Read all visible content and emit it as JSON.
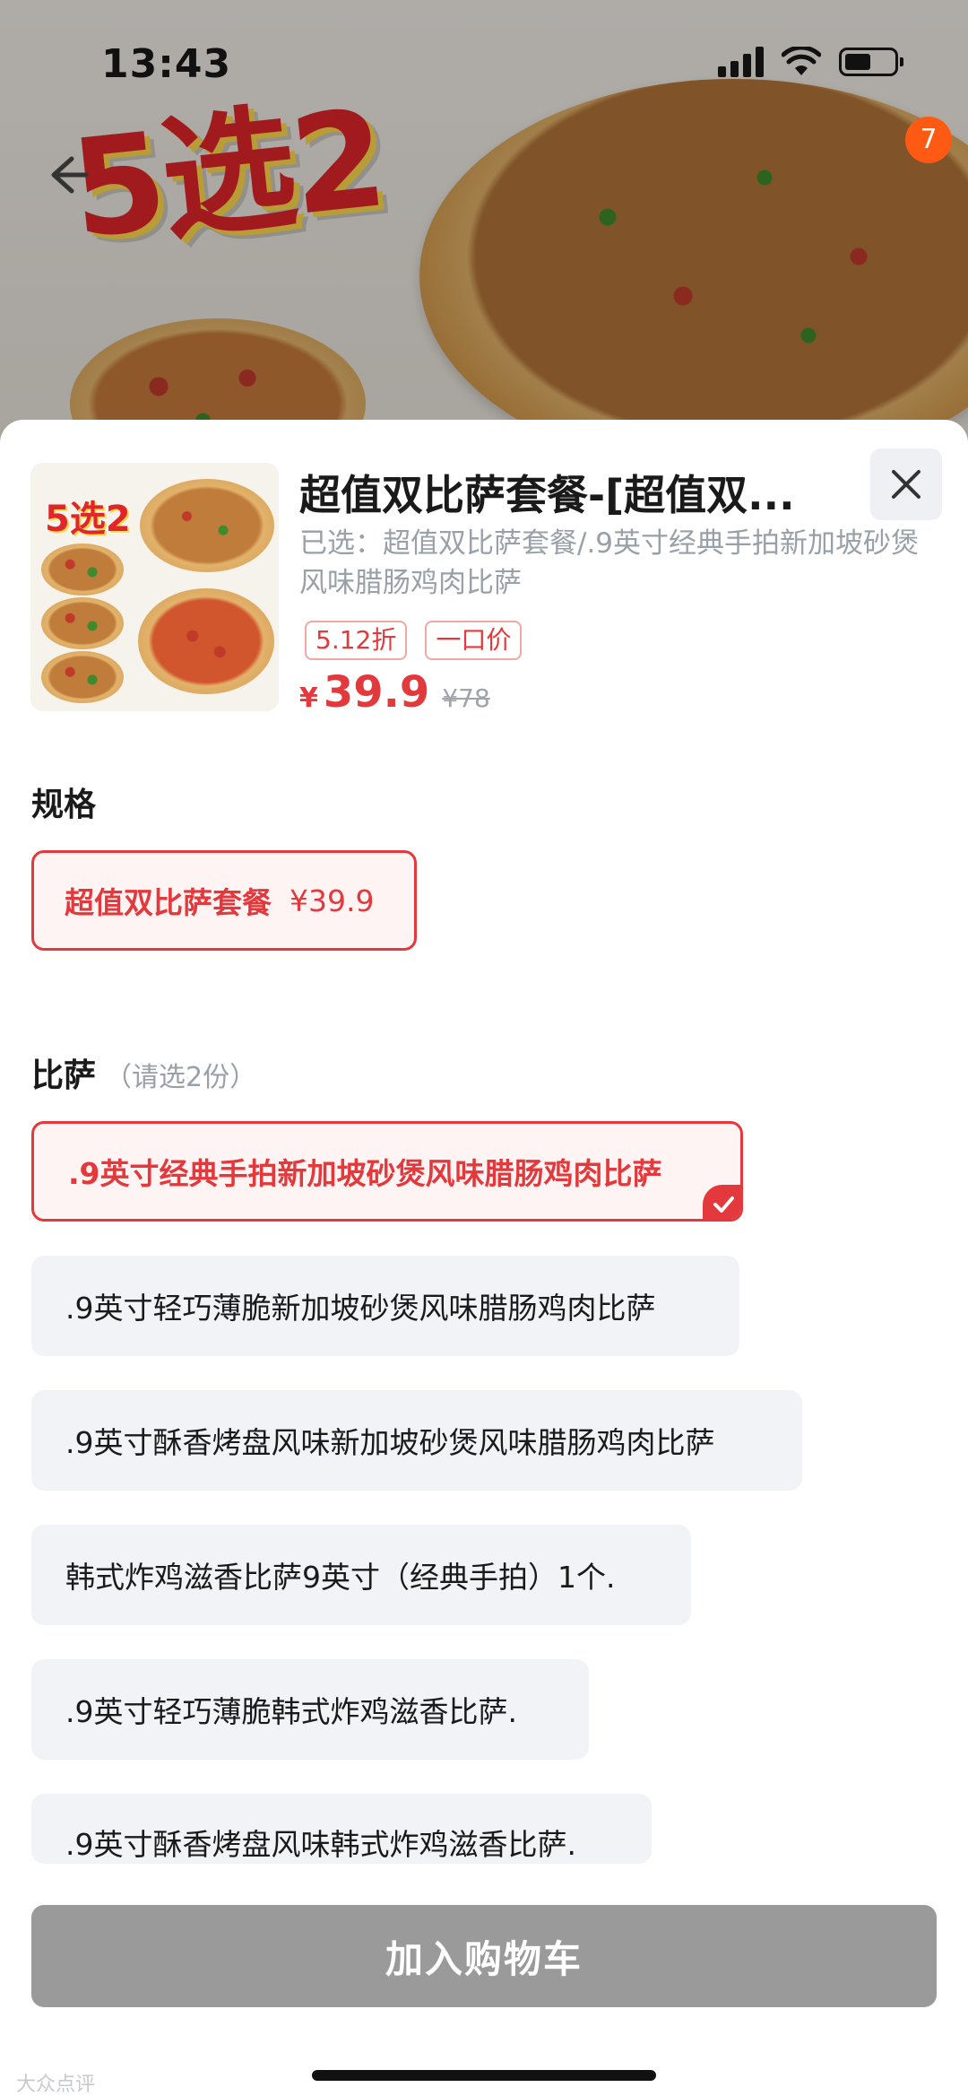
{
  "status_bar": {
    "time": "13:43"
  },
  "banner": {
    "promo_text": "5选2",
    "cart_count": "7"
  },
  "product": {
    "thumb_badge": "5选2",
    "title": "超值双比萨套餐-[超值双...",
    "selected_text": "已选：超值双比萨套餐/.9英寸经典手拍新加坡砂煲风味腊肠鸡肉比萨",
    "tags": [
      "5.12折",
      "一口价"
    ],
    "price_symbol": "¥",
    "price_current": "39.9",
    "price_original": "¥78"
  },
  "spec_section": {
    "title": "规格",
    "options": [
      {
        "label": "超值双比萨套餐",
        "price": "¥39.9",
        "selected": true
      }
    ]
  },
  "pizza_section": {
    "title": "比萨",
    "hint": "（请选2份）",
    "options": [
      {
        "label": ".9英寸经典手拍新加坡砂煲风味腊肠鸡肉比萨",
        "selected": true
      },
      {
        "label": ".9英寸轻巧薄脆新加坡砂煲风味腊肠鸡肉比萨",
        "selected": false
      },
      {
        "label": ".9英寸酥香烤盘风味新加坡砂煲风味腊肠鸡肉比萨",
        "selected": false
      },
      {
        "label": "韩式炸鸡滋香比萨9英寸（经典手拍）1个.",
        "selected": false
      },
      {
        "label": ".9英寸轻巧薄脆韩式炸鸡滋香比萨.",
        "selected": false
      },
      {
        "label": ".9英寸酥香烤盘风味韩式炸鸡滋香比萨.",
        "selected": false
      }
    ]
  },
  "footer": {
    "add_to_cart": "加入购物车",
    "watermark": "大众点评"
  },
  "colors": {
    "accent": "#e4393c",
    "selected_bg": "#fff4f4",
    "option_bg": "#f1f3f6",
    "button_disabled": "#9a9a9a",
    "cart_badge": "#ff5a14"
  },
  "icons": [
    "back-arrow-icon",
    "signal-icon",
    "wifi-icon",
    "battery-icon",
    "close-icon",
    "check-icon"
  ]
}
